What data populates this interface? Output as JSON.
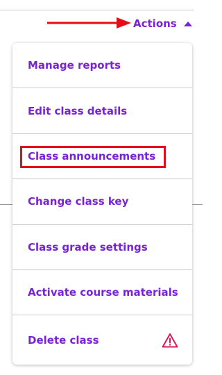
{
  "header": {
    "actions_label": "Actions"
  },
  "menu": {
    "items": [
      {
        "label": "Manage reports"
      },
      {
        "label": "Edit class details"
      },
      {
        "label": "Class announcements"
      },
      {
        "label": "Change class key"
      },
      {
        "label": "Class grade settings"
      },
      {
        "label": "Activate course materials"
      },
      {
        "label": "Delete class"
      }
    ]
  },
  "icons": {
    "actions_caret": "caret-up-icon",
    "delete_warning": "warning-triangle-icon",
    "annotation_arrow": "red-arrow-icon"
  },
  "colors": {
    "accent": "#7a22d6",
    "highlight": "#e20d19",
    "warning": "#d6195a"
  }
}
